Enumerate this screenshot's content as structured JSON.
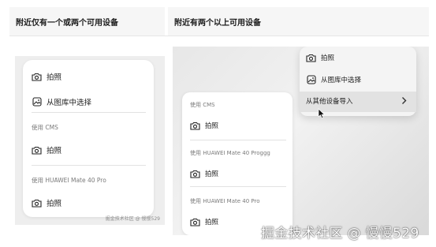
{
  "headers": {
    "left": "附近仅有一个或两个可用设备",
    "right": "附近有两个以上可用设备"
  },
  "left_panel": {
    "take_photo": "拍照",
    "choose_gallery": "从图库中选择",
    "section1_label": "使用 CMS",
    "section1_action": "拍照",
    "section2_label": "使用 HUAWEI Mate 40 Pro",
    "section2_action": "拍照",
    "watermark": "掘金技术社区 @ 慢慢529"
  },
  "right_panel": {
    "menu": {
      "take_photo": "拍照",
      "choose_gallery": "从图库中选择",
      "import_other": "从其他设备导入"
    },
    "card": {
      "section1_label": "使用 CMS",
      "section1_action": "拍照",
      "section2_label": "使用 HUAWEI Mate 40 Proggg",
      "section2_action": "拍照",
      "section3_label": "使用 HUAWEI Mate 40 Pro",
      "section3_action": "拍照"
    }
  },
  "watermark": "掘金技术社区 @ 慢慢529"
}
